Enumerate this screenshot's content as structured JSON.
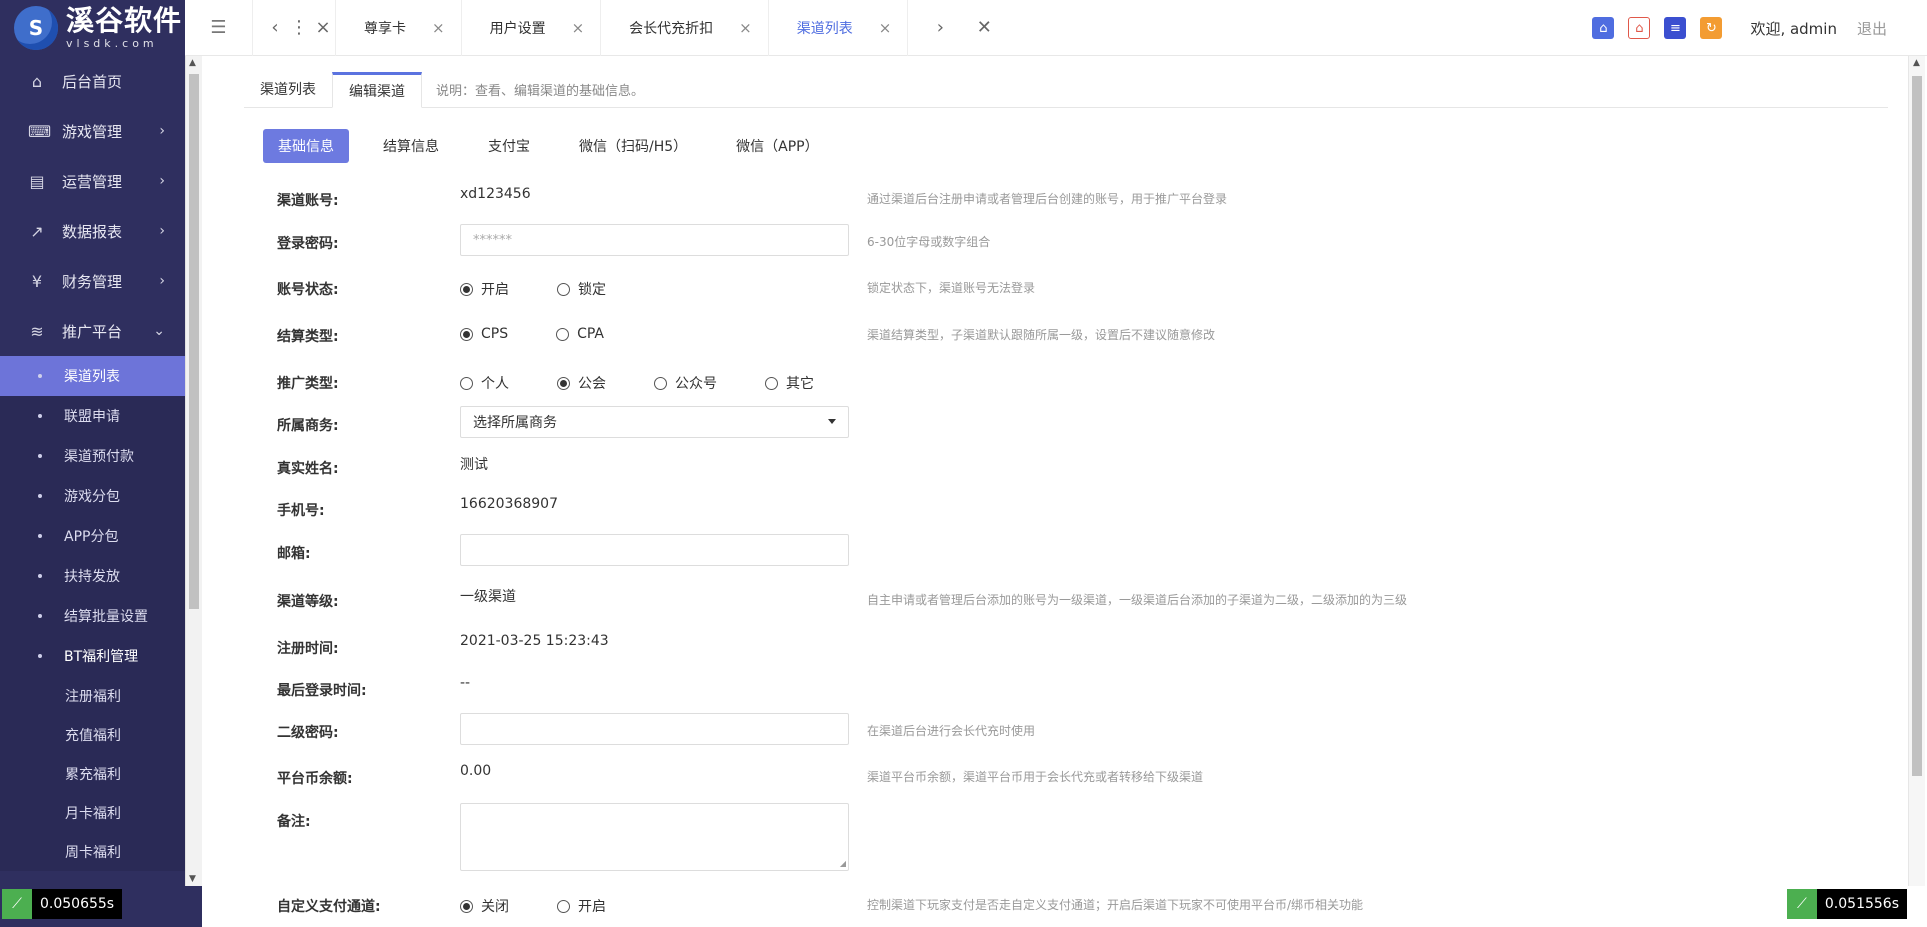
{
  "app": {
    "logo_main": "溪谷软件",
    "logo_sub": "vlsdk.com",
    "logo_glyph": "S"
  },
  "sidebar": {
    "items": [
      {
        "label": "后台首页",
        "icon": "⌂"
      },
      {
        "label": "游戏管理",
        "icon": "🎮"
      },
      {
        "label": "运营管理",
        "icon": "⎍"
      },
      {
        "label": "数据报表",
        "icon": "↗"
      },
      {
        "label": "财务管理",
        "icon": "¥"
      },
      {
        "label": "推广平台",
        "icon": "≋"
      }
    ],
    "sub_items": [
      "渠道列表",
      "联盟申请",
      "渠道预付款",
      "游戏分包",
      "APP分包",
      "扶持发放",
      "结算批量设置",
      "BT福利管理"
    ],
    "subsub_items": [
      "注册福利",
      "充值福利",
      "累充福利",
      "月卡福利",
      "周卡福利"
    ]
  },
  "topbar": {
    "tabs": [
      "尊享卡",
      "用户设置",
      "会长代充折扣",
      "渠道列表"
    ],
    "welcome": "欢迎, admin",
    "logout": "退出",
    "quick_icons": [
      "home-icon",
      "store-icon",
      "list-icon",
      "refresh-icon"
    ]
  },
  "page": {
    "tabs": [
      "渠道列表",
      "编辑渠道"
    ],
    "note": "说明：查看、编辑渠道的基础信息。",
    "section_tabs": [
      "基础信息",
      "结算信息",
      "支付宝",
      "微信（扫码/H5）",
      "微信（APP）"
    ]
  },
  "form": {
    "account": {
      "label": "渠道账号:",
      "value": "xd123456",
      "hint": "通过渠道后台注册申请或者管理后台创建的账号，用于推广平台登录"
    },
    "password": {
      "label": "登录密码:",
      "placeholder": "******",
      "hint": "6-30位字母或数字组合"
    },
    "status": {
      "label": "账号状态:",
      "options": [
        "开启",
        "锁定"
      ],
      "hint": "锁定状态下，渠道账号无法登录"
    },
    "settle_type": {
      "label": "结算类型:",
      "options": [
        "CPS",
        "CPA"
      ],
      "hint": "渠道结算类型，子渠道默认跟随所属一级，设置后不建议随意修改"
    },
    "promo_type": {
      "label": "推广类型:",
      "options": [
        "个人",
        "公会",
        "公众号",
        "其它"
      ]
    },
    "business": {
      "label": "所属商务:",
      "value": "选择所属商务"
    },
    "real_name": {
      "label": "真实姓名:",
      "value": "测试"
    },
    "phone": {
      "label": "手机号:",
      "value": "16620368907"
    },
    "email": {
      "label": "邮箱:"
    },
    "level": {
      "label": "渠道等级:",
      "value": "一级渠道",
      "hint": "自主申请或者管理后台添加的账号为一级渠道，一级渠道后台添加的子渠道为二级，二级添加的为三级"
    },
    "reg_time": {
      "label": "注册时间:",
      "value": "2021-03-25 15:23:43"
    },
    "last_login": {
      "label": "最后登录时间:",
      "value": "--"
    },
    "second_pwd": {
      "label": "二级密码:",
      "hint": "在渠道后台进行会长代充时使用"
    },
    "balance": {
      "label": "平台币余额:",
      "value": "0.00",
      "hint": "渠道平台币余额，渠道平台币用于会长代充或者转移给下级渠道"
    },
    "remark": {
      "label": "备注:"
    },
    "custom_pay": {
      "label": "自定义支付通道:",
      "options": [
        "关闭",
        "开启"
      ],
      "hint": "控制渠道下玩家支付是否走自定义支付通道；开启后渠道下玩家不可使用平台币/绑币相关功能"
    }
  },
  "timers": {
    "left": "0.050655s",
    "right": "0.051556s"
  },
  "colors": {
    "sidebar_bg": "#2f2f5f",
    "accent": "#6d7ae0",
    "active_sub": "#6d74d9"
  }
}
